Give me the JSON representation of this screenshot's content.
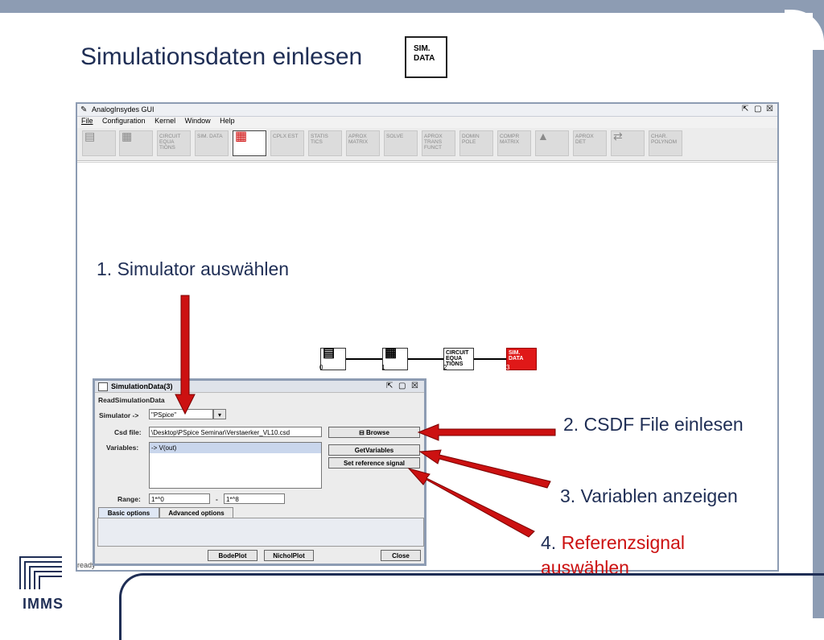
{
  "slide": {
    "title": "Simulationsdaten einlesen",
    "title_icon_text": "SIM.\nDATA",
    "logo_text": "IMMS"
  },
  "app": {
    "title": "AnalogInsydes GUI",
    "menu": [
      "File",
      "Configuration",
      "Kernel",
      "Window",
      "Help"
    ],
    "toolbar": [
      {
        "label": "",
        "icon": "circuit-image-icon"
      },
      {
        "label": "",
        "icon": "chip-icon"
      },
      {
        "label": "CIRCUIT EQUA TIONS"
      },
      {
        "label": "SIM. DATA"
      },
      {
        "label": "",
        "icon": "sim-data-table-icon",
        "active": true
      },
      {
        "label": "CPLX EST"
      },
      {
        "label": "STATIS TICS"
      },
      {
        "label": "APROX MATRIX"
      },
      {
        "label": "SOLVE"
      },
      {
        "label": "APROX TRANS FUNCT"
      },
      {
        "label": "DOMIN POLE"
      },
      {
        "label": "COMPR MATRIX"
      },
      {
        "label": "",
        "icon": "surface-plot-icon"
      },
      {
        "label": "APROX DET"
      },
      {
        "label": "",
        "icon": "arrows-icon"
      },
      {
        "label": "CHAR. POLYNOM"
      }
    ],
    "status": "ready"
  },
  "flow": {
    "nodes": [
      {
        "label": "",
        "icon": "circuit-image-icon",
        "index": "0"
      },
      {
        "label": "",
        "icon": "chip-icon",
        "index": "1"
      },
      {
        "label": "CIRCUIT EQUA TIONS",
        "index": "2"
      },
      {
        "label": "SIM. DATA",
        "index": "3",
        "highlight": true
      }
    ]
  },
  "dialog": {
    "title": "SimulationData(3)",
    "section": "ReadSimulationData",
    "simulator_label": "Simulator ->",
    "simulator_value": "\"PSpice\"",
    "csd_label": "Csd file:",
    "csd_value": "\\Desktop\\PSpice Seminar\\Verstaerker_VL10.csd",
    "browse": "Browse",
    "variables_label": "Variables:",
    "variables": [
      "-> V(out)"
    ],
    "get_variables": "GetVariables",
    "set_reference": "Set reference signal",
    "range_label": "Range:",
    "range_from": "1*^0",
    "range_sep": "-",
    "range_to": "1*^8",
    "tabs": [
      "Basic options",
      "Advanced options"
    ],
    "buttons": [
      "BodePlot",
      "NicholPlot",
      "Close"
    ]
  },
  "annotations": {
    "a1": "1. Simulator auswählen",
    "a2": "2. CSDF File einlesen",
    "a3": "3. Variablen anzeigen",
    "a4_num": "4. ",
    "a4_text": "Referenzsignal auswählen"
  },
  "colors": {
    "frame": "#8d9cb3",
    "title": "#1f2e55",
    "arrow": "#cc1111",
    "highlight_node": "#e01818"
  }
}
